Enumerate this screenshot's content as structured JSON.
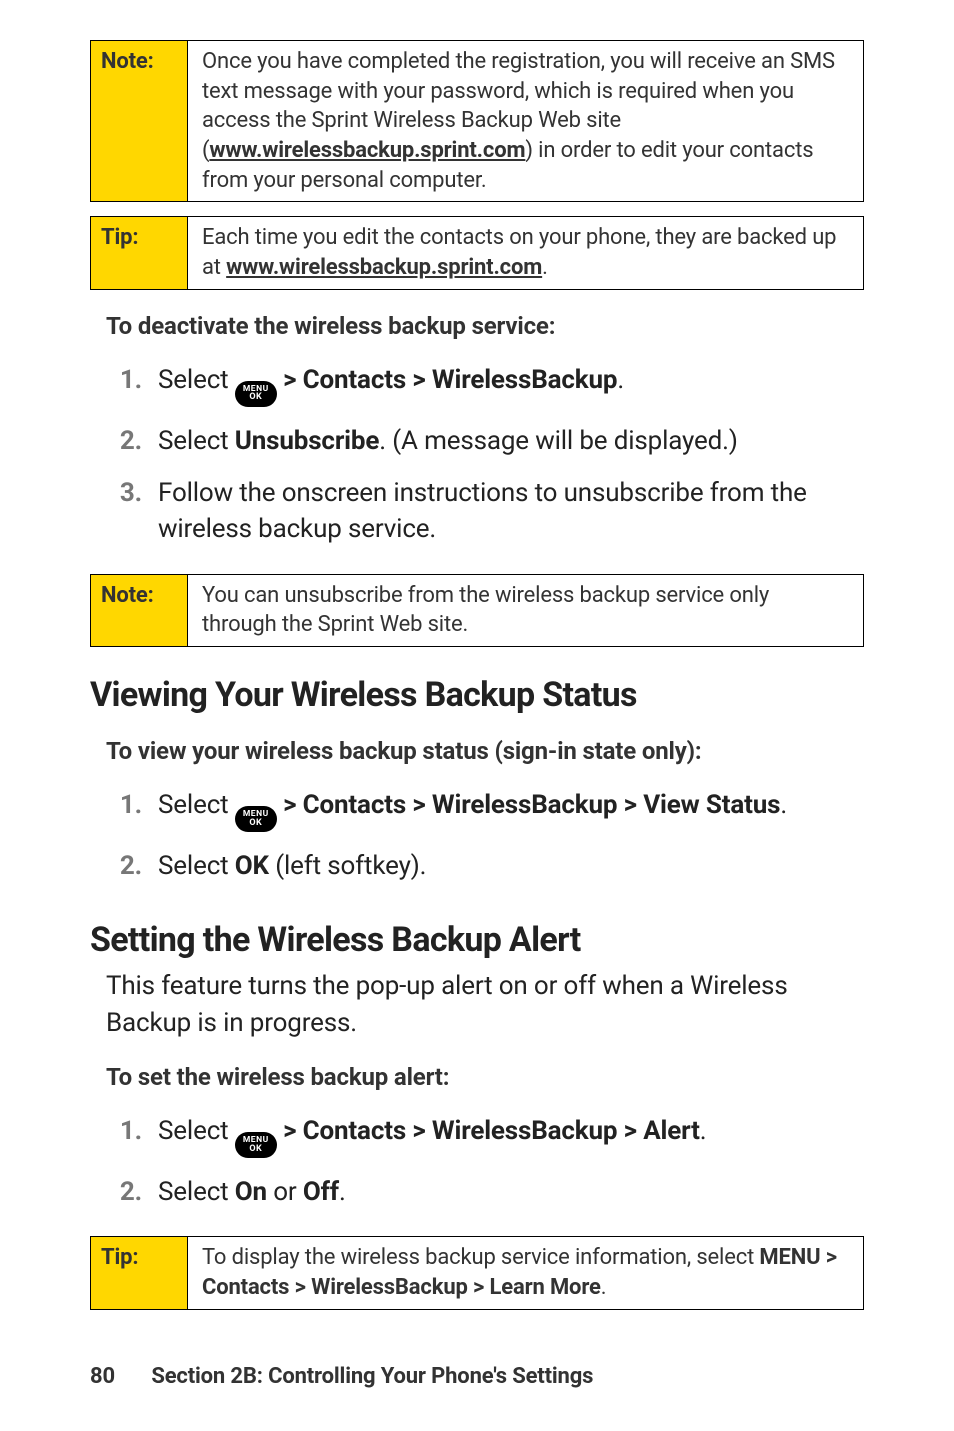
{
  "callouts": {
    "note1": {
      "tag": "Note:",
      "text_before": "Once you have completed the registration, you will receive an SMS text message with your password, which is  required when you access the Sprint Wireless Backup Web site (",
      "link": "www.wirelessbackup.sprint.com",
      "text_after": ") in order to edit your contacts from your personal computer."
    },
    "tip1": {
      "tag": "Tip:",
      "text_before": "Each time you edit the contacts on your phone, they are backed up at ",
      "link": "www.wirelessbackup.sprint.com",
      "text_after": "."
    },
    "note2": {
      "tag": "Note:",
      "text": "You can unsubscribe from the wireless backup service only through the Sprint Web site."
    },
    "tip2": {
      "tag": "Tip:",
      "text_before": "To display the wireless backup service information, select ",
      "bold": "MENU > Contacts > WirelessBackup > Learn More",
      "text_after": "."
    }
  },
  "leads": {
    "deactivate": "To deactivate the wireless backup service:",
    "viewstatus": "To view your wireless backup status (sign-in state only):",
    "setalert": "To set the wireless backup alert:"
  },
  "headings": {
    "viewing": "Viewing Your Wireless Backup Status",
    "setting": "Setting the Wireless Backup Alert"
  },
  "paras": {
    "setting_intro": "This feature turns the pop-up alert on or off when a Wireless Backup is in progress."
  },
  "lists": {
    "deactivate": [
      {
        "n": "1.",
        "pre": "Select ",
        "menu": true,
        "mid": " ",
        "b1": "> Contacts > WirelessBackup",
        "post": "."
      },
      {
        "n": "2.",
        "pre": "Select ",
        "b1": "Unsubscribe",
        "post": ". (A message will be displayed.)"
      },
      {
        "n": "3.",
        "pre": "Follow the onscreen instructions to unsubscribe from the wireless backup service."
      }
    ],
    "viewstatus": [
      {
        "n": "1.",
        "pre": "Select ",
        "menu": true,
        "mid": " ",
        "b1": "> Contacts > WirelessBackup > View Status",
        "post": "."
      },
      {
        "n": "2.",
        "pre": "Select ",
        "b1": "OK",
        "post": " (left softkey)."
      }
    ],
    "setalert": [
      {
        "n": "1.",
        "pre": "Select ",
        "menu": true,
        "mid": " ",
        "b1": "> Contacts > WirelessBackup > Alert",
        "post": "."
      },
      {
        "n": "2.",
        "pre": "Select ",
        "b1": "On",
        "mid2": " or ",
        "b2": "Off",
        "post": "."
      }
    ]
  },
  "pill": {
    "l1": "MENU",
    "l2": "OK"
  },
  "footer": {
    "page": "80",
    "text": "Section 2B: Controlling Your Phone's Settings"
  }
}
